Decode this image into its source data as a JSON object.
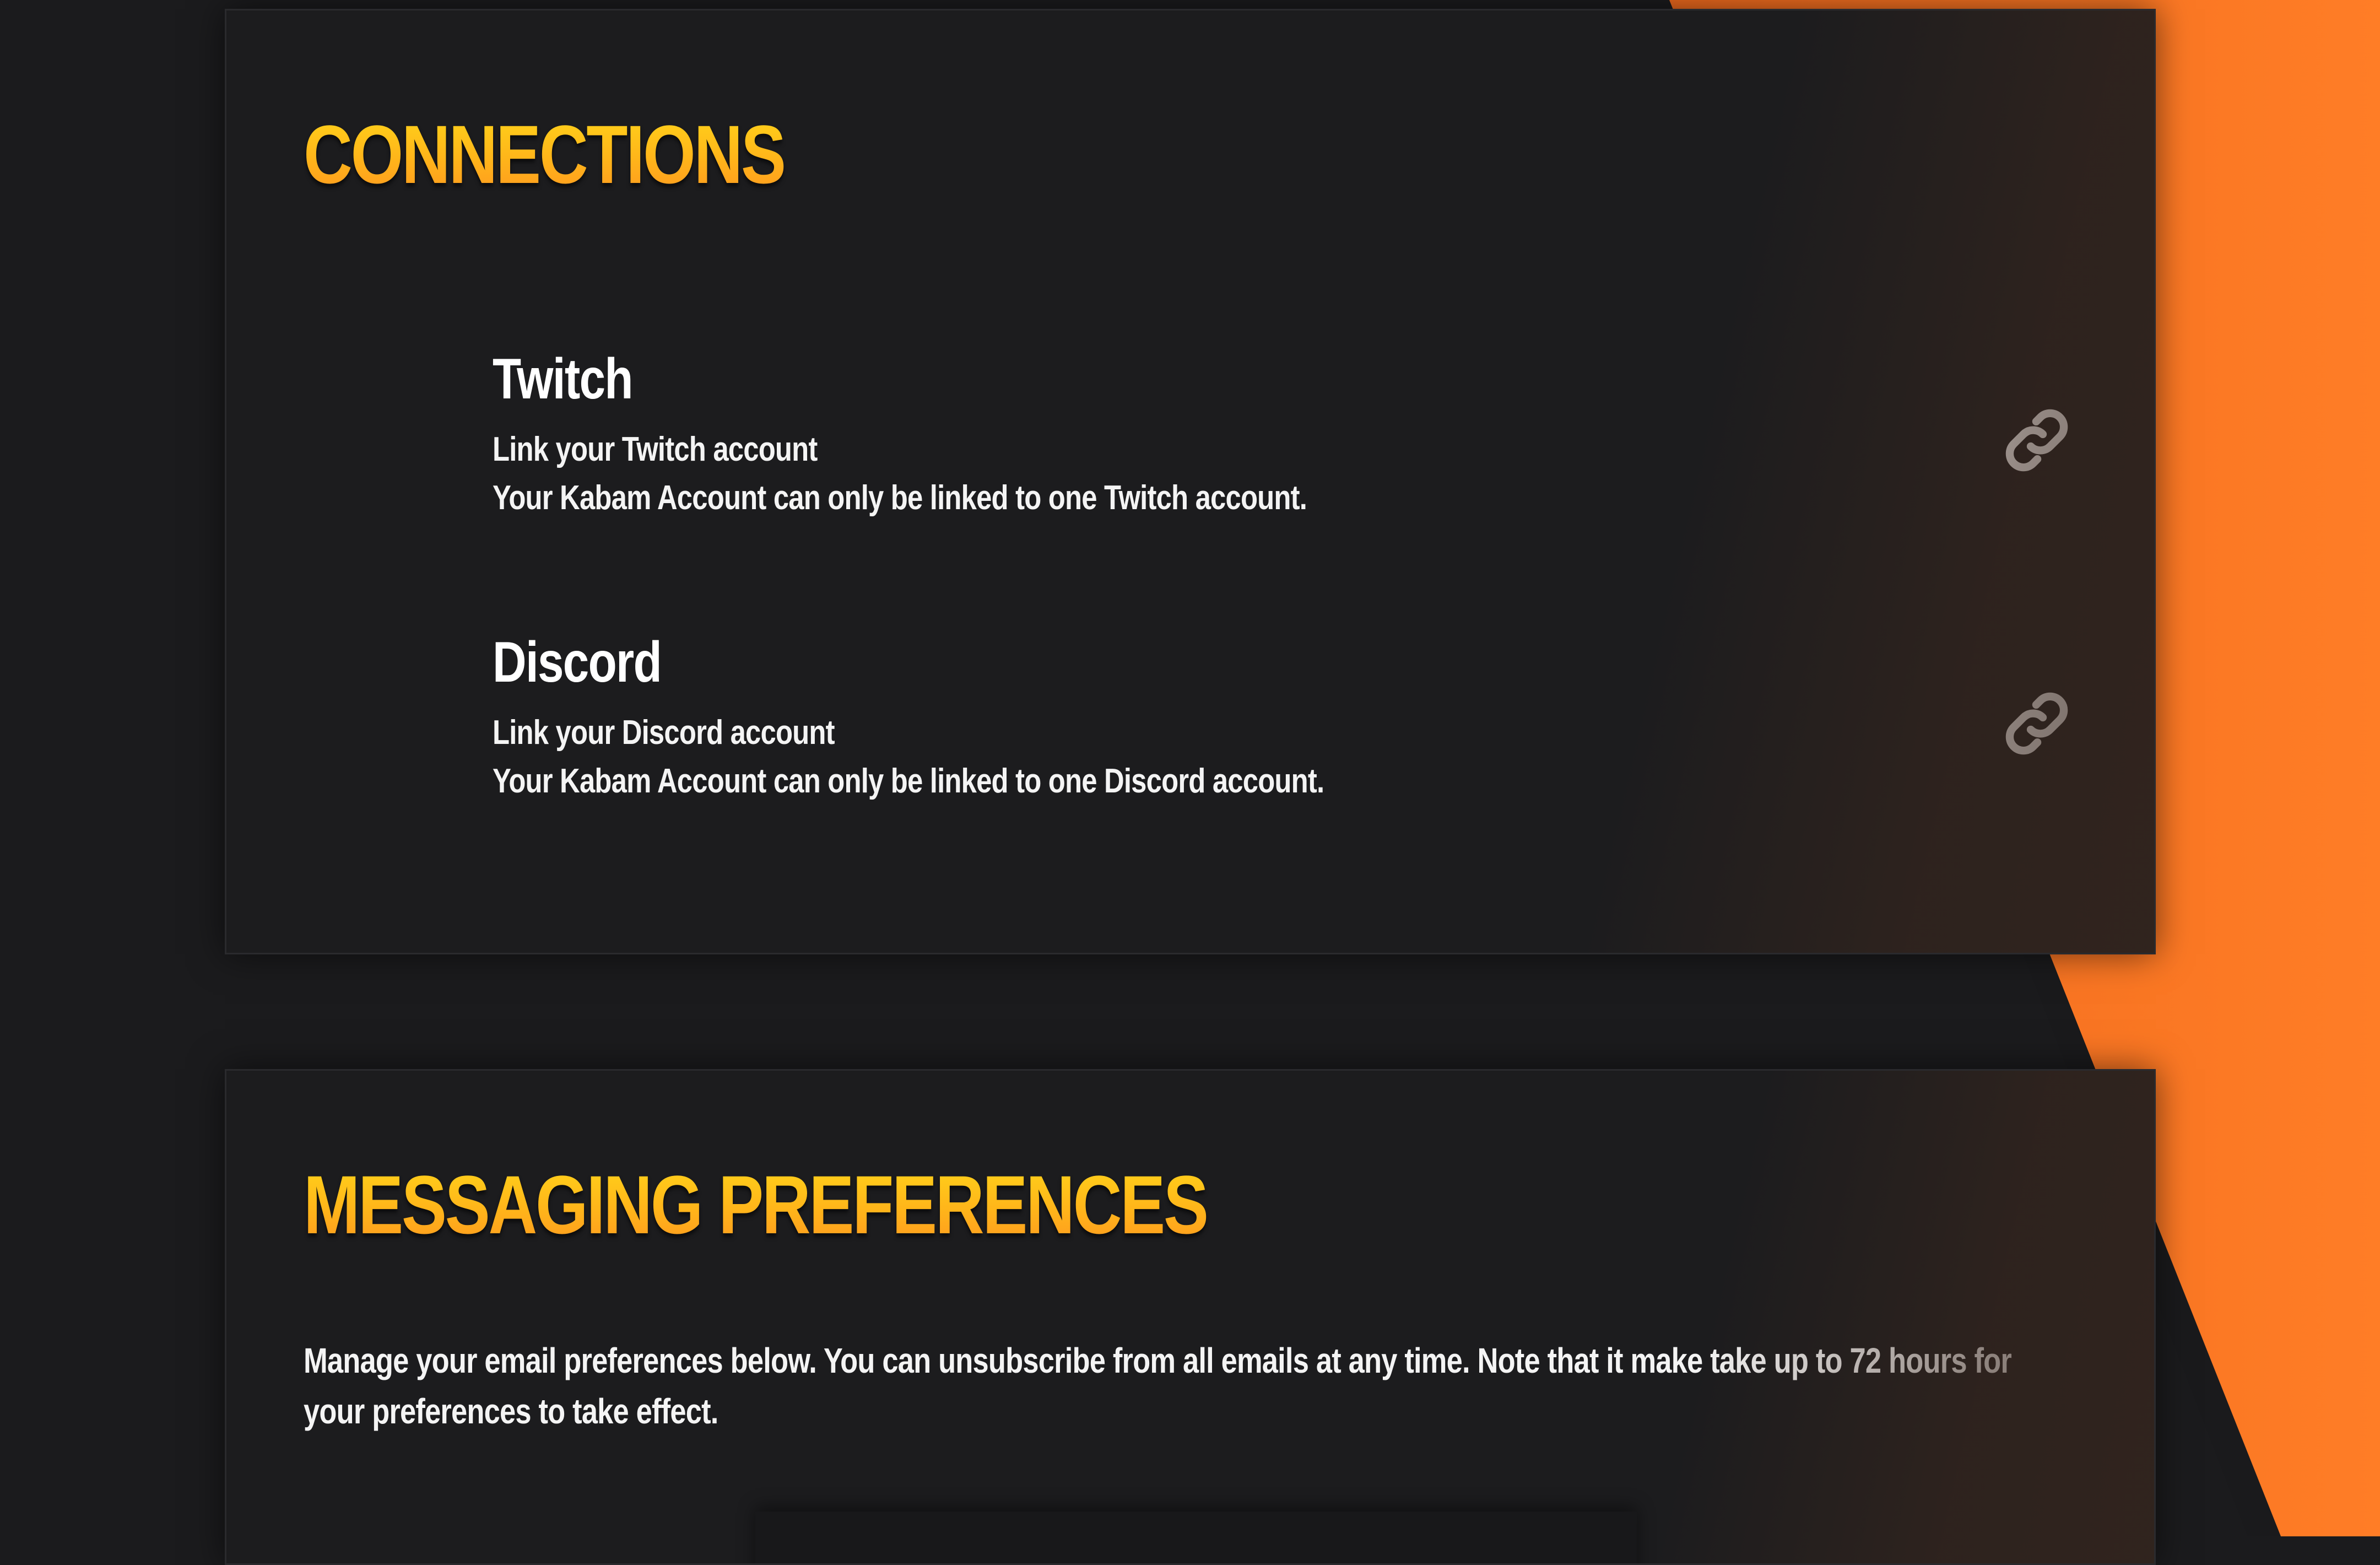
{
  "connections": {
    "title": "CONNECTIONS",
    "items": [
      {
        "name": "Twitch",
        "line1": "Link your Twitch account",
        "line2": "Your Kabam Account can only be linked to one Twitch account.",
        "icon": "link-icon"
      },
      {
        "name": "Discord",
        "line1": "Link your Discord account",
        "line2": "Your Kabam Account can only be linked to one Discord account.",
        "icon": "link-icon"
      }
    ]
  },
  "messaging": {
    "title": "MESSAGING PREFERENCES",
    "description": "Manage your email preferences below. You can unsubscribe from all emails at any time. Note that it make take up to 72 hours for your preferences to take effect."
  },
  "colors": {
    "background": "#1b1b1d",
    "card": "#1c1c1e",
    "accent_orange": "#ff7a22",
    "title_gradient_top": "#ffd21a",
    "title_gradient_bottom": "#ff9a1f",
    "text": "#ffffff"
  }
}
